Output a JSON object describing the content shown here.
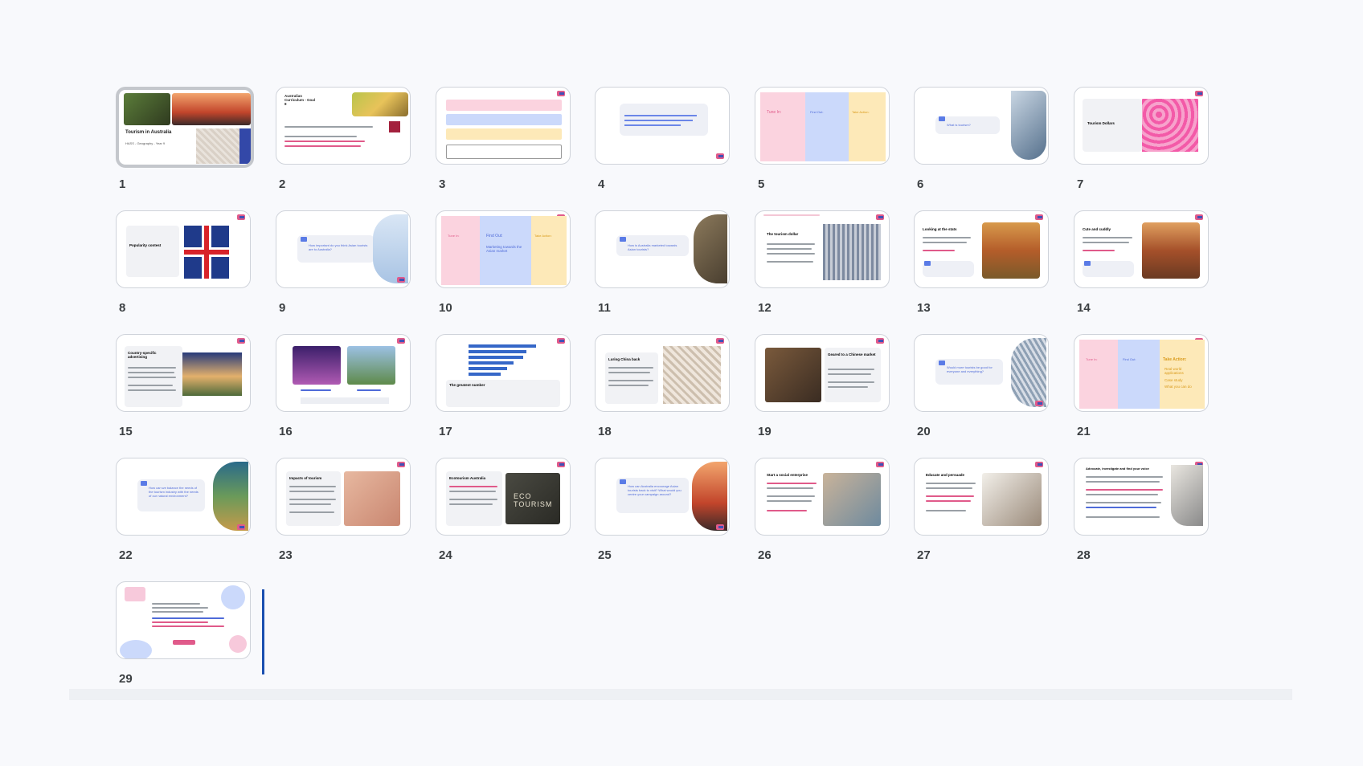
{
  "slides": [
    {
      "n": "1",
      "title": "Tourism in Australia",
      "subtitle": "HASS - Geography - Year 9",
      "selected": true
    },
    {
      "n": "2",
      "title": "Australian Curriculum - Goal 8"
    },
    {
      "n": "3"
    },
    {
      "n": "4"
    },
    {
      "n": "5",
      "cols": [
        "Tune In:",
        "Find Out:",
        "Take Action:"
      ]
    },
    {
      "n": "6",
      "question": "What is tourism?"
    },
    {
      "n": "7",
      "title": "Tourism Dollars"
    },
    {
      "n": "8",
      "title": "Popularity contest"
    },
    {
      "n": "9",
      "question": "How important do you think Asian tourists are to Australia?"
    },
    {
      "n": "10",
      "cols": [
        "Tune In:",
        "Find Out:",
        "Take Action:"
      ],
      "find": "Marketing towards the Asian market"
    },
    {
      "n": "11",
      "question": "How is Australia marketed towards Asian tourists?"
    },
    {
      "n": "12",
      "title": "The tourism dollar"
    },
    {
      "n": "13",
      "title": "Looking at the stats"
    },
    {
      "n": "14",
      "title": "Cute and cuddly"
    },
    {
      "n": "15",
      "title": "Country-specific advertising"
    },
    {
      "n": "16"
    },
    {
      "n": "17",
      "title": "The greatest number"
    },
    {
      "n": "18",
      "title": "Luring China back"
    },
    {
      "n": "19",
      "title": "Geared to a Chinese market"
    },
    {
      "n": "20",
      "question": "Would more tourists be good for everyone and everything?"
    },
    {
      "n": "21",
      "cols": [
        "Tune In:",
        "Find Out:",
        "Take Action:"
      ],
      "take": [
        "Real world applications",
        "Case study",
        "What you can do"
      ]
    },
    {
      "n": "22",
      "question": "How can we balance the needs of the tourism industry with the needs of our natural environment?"
    },
    {
      "n": "23",
      "title": "Impacts of tourism"
    },
    {
      "n": "24",
      "title": "Ecotourism Australia",
      "photo_text": "ECO TOURISM"
    },
    {
      "n": "25",
      "question": "How can Australia encourage Asian tourists back to visit? What would you centre your campaign around?"
    },
    {
      "n": "26",
      "title": "Start a social enterprise"
    },
    {
      "n": "27",
      "title": "Educate and persuade"
    },
    {
      "n": "28",
      "title": "Advocate, investigate and find your voice"
    },
    {
      "n": "29"
    }
  ],
  "colors": {
    "accent": "#e05a8a",
    "blue": "#4f6bd9",
    "pink": "#f9d6e2",
    "lightblue": "#c9d8f9",
    "yellow": "#fdeecb"
  }
}
